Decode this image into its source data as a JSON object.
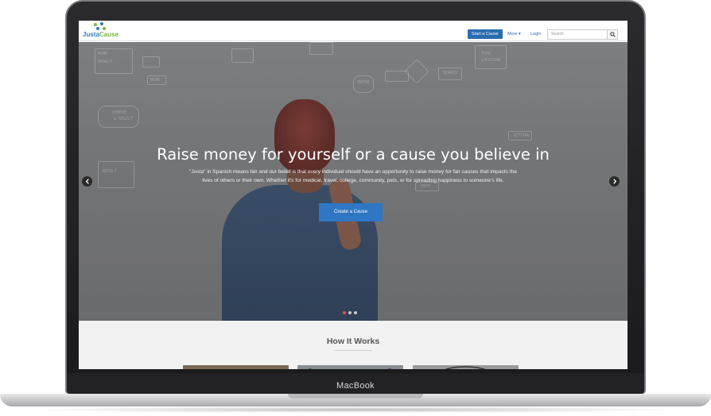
{
  "device": {
    "label": "MacBook"
  },
  "nav": {
    "logo": {
      "part1": "Justa",
      "part2": "Cause"
    },
    "start_label": "Start a Cause",
    "more_label": "More ▾",
    "login_label": "Login",
    "search_placeholder": "Search",
    "search_icon": "search-icon"
  },
  "hero": {
    "title": "Raise money for yourself or a cause you believe in",
    "text": "\"Justa\" in Spanish means fair and our belief is that every individual should have an opportunity to raise money for fair causes that impacts the lives of others or their own. Whether it's for medical, travel, college, community, pets, or for spreading happiness to someone's life.",
    "button_label": "Create a Cause",
    "prev_icon": "chevron-left-icon",
    "next_icon": "chevron-right-icon",
    "slide_count": 3,
    "active_slide": 1
  },
  "how_it_works": {
    "title": "How It Works"
  },
  "colors": {
    "brand_blue": "#2b6cb0",
    "brand_green": "#7cb342",
    "cta_blue": "#2f76c4",
    "active_dot": "#e0533c"
  }
}
